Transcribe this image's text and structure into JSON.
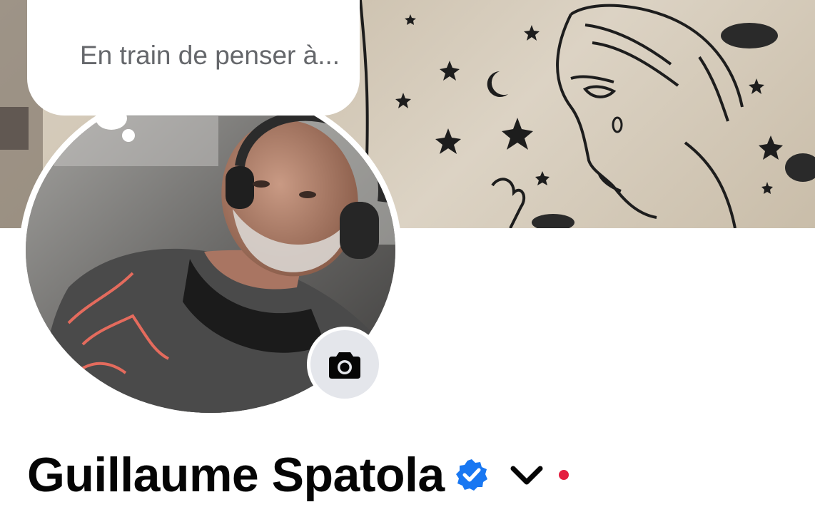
{
  "thought_bubble": {
    "placeholder": "En train de penser à..."
  },
  "profile": {
    "name": "Guillaume Spatola",
    "verified": true,
    "verified_color": "#1877f2",
    "notification_dot_color": "#e41e3f"
  },
  "icons": {
    "camera": "camera-icon",
    "verified": "verified-badge-icon",
    "dropdown": "chevron-down-icon"
  },
  "colors": {
    "placeholder_text": "#65676b",
    "name_text": "#050505",
    "camera_button_bg": "#e4e6eb"
  }
}
